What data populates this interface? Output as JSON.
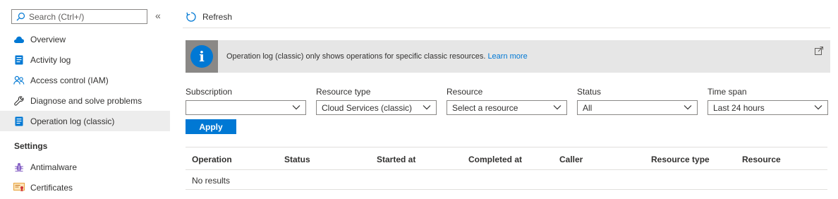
{
  "sidebar": {
    "search_placeholder": "Search (Ctrl+/)",
    "collapse_glyph": "«",
    "items": [
      {
        "label": "Overview",
        "icon": "cloud-icon"
      },
      {
        "label": "Activity log",
        "icon": "log-icon"
      },
      {
        "label": "Access control (IAM)",
        "icon": "people-icon"
      },
      {
        "label": "Diagnose and solve problems",
        "icon": "wrench-icon"
      },
      {
        "label": "Operation log (classic)",
        "icon": "log-icon",
        "active": true
      }
    ],
    "settings_header": "Settings",
    "settings_items": [
      {
        "label": "Antimalware",
        "icon": "bug-icon"
      },
      {
        "label": "Certificates",
        "icon": "certificate-icon"
      }
    ]
  },
  "toolbar": {
    "refresh_label": "Refresh"
  },
  "info_bar": {
    "message": "Operation log (classic) only shows operations for specific classic resources.",
    "link_text": "Learn more"
  },
  "filters": [
    {
      "label": "Subscription",
      "value": ""
    },
    {
      "label": "Resource type",
      "value": "Cloud Services (classic)"
    },
    {
      "label": "Resource",
      "value": "Select a resource"
    },
    {
      "label": "Status",
      "value": "All"
    },
    {
      "label": "Time span",
      "value": "Last 24 hours"
    }
  ],
  "apply_label": "Apply",
  "table": {
    "columns": [
      "Operation",
      "Status",
      "Started at",
      "Completed at",
      "Caller",
      "Resource type",
      "Resource"
    ],
    "empty_text": "No results"
  },
  "colors": {
    "accent": "#0078d4",
    "active_row": "#ededed",
    "info_bg": "#e6e6e6"
  }
}
